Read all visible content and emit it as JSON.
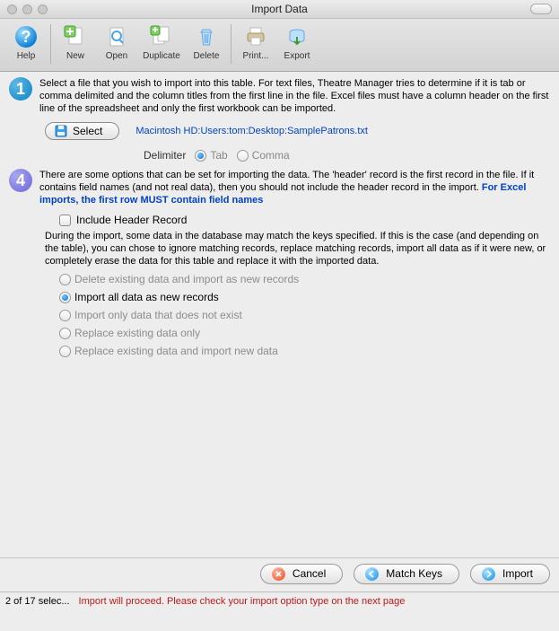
{
  "window": {
    "title": "Import Data"
  },
  "toolbar": {
    "help": "Help",
    "new": "New",
    "open": "Open",
    "duplicate": "Duplicate",
    "delete": "Delete",
    "print": "Print...",
    "export": "Export"
  },
  "step1": {
    "text": "Select a file that you wish to import into this table.  For text files, Theatre Manager tries to determine if it is tab or comma delimited and the column titles from the first line in the file.  Excel files must have a column header on the first line of the spreadsheet and only the first workbook can be imported.",
    "select_label": "Select",
    "filepath": "Macintosh HD:Users:tom:Desktop:SamplePatrons.txt"
  },
  "delimiter": {
    "label": "Delimiter",
    "tab": "Tab",
    "comma": "Comma",
    "selected": "Tab"
  },
  "step4": {
    "text_main": "There are some options that can be set for importing the data.    The 'header' record is the first record in the file.  If it contains field names (and not real data), then you should not include the header record in the import.  ",
    "text_bold": "For Excel imports, the first row MUST contain field names",
    "checkbox_label": "Include Header Record",
    "text2": "During the import, some data in the database may match the keys specified.  If this is the case (and depending on the table), you can chose to ignore matching records, replace matching records, import all data as if it were new, or completely erase the data for this table and replace it with the imported data.",
    "options": [
      "Delete existing data and import as new records",
      "Import all data as new records",
      "Import only data that does not exist",
      "Replace existing data only",
      "Replace existing data and import new data"
    ],
    "selected_option_index": 1
  },
  "buttons": {
    "cancel": "Cancel",
    "match_keys": "Match Keys",
    "import": "Import"
  },
  "status": {
    "left": "2 of 17 selec...",
    "message": "Import will proceed.  Please check your import option type on the next page"
  }
}
